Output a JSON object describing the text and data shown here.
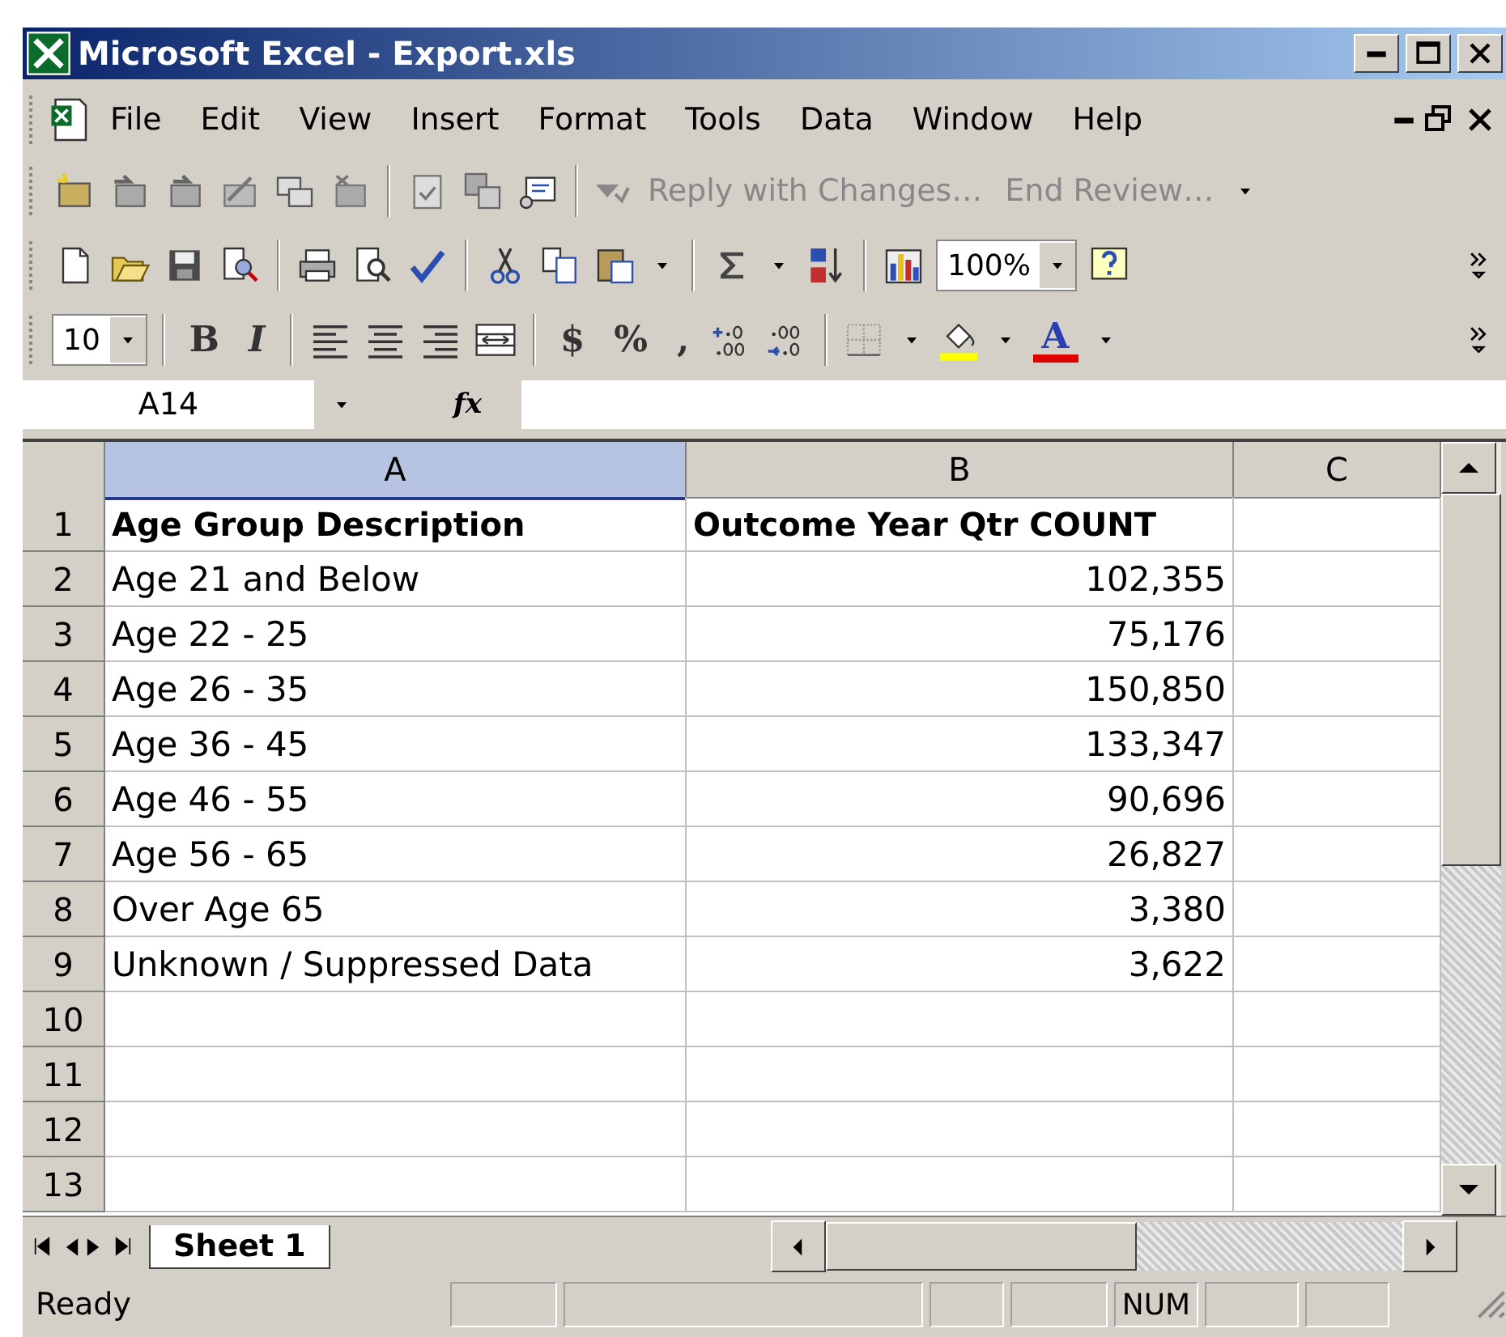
{
  "window": {
    "title": "Microsoft Excel - Export.xls"
  },
  "menu": [
    {
      "label": "File"
    },
    {
      "label": "Edit"
    },
    {
      "label": "View"
    },
    {
      "label": "Insert"
    },
    {
      "label": "Format"
    },
    {
      "label": "Tools"
    },
    {
      "label": "Data"
    },
    {
      "label": "Window"
    },
    {
      "label": "Help"
    }
  ],
  "review_toolbar": {
    "reply": "Reply with Changes…",
    "end_review": "End Review…"
  },
  "standard_toolbar": {
    "zoom": "100%"
  },
  "formatting_toolbar": {
    "font_size": "10",
    "bold": "B",
    "italic": "I",
    "currency": "$",
    "percent": "%",
    "comma": ",",
    "font_color": "A"
  },
  "formula_bar": {
    "name_box": "A14",
    "function_label": "fx"
  },
  "sheet": {
    "columns": [
      {
        "label": "A",
        "selected": true
      },
      {
        "label": "B",
        "selected": false
      },
      {
        "label": "C",
        "selected": false
      }
    ],
    "rows": [
      {
        "number": "1",
        "kind": "header",
        "a": "Age Group Description",
        "b": "Outcome Year Qtr COUNT"
      },
      {
        "number": "2",
        "kind": "data",
        "a": "Age 21 and Below",
        "b": "102,355"
      },
      {
        "number": "3",
        "kind": "data",
        "a": "Age 22 - 25",
        "b": "75,176"
      },
      {
        "number": "4",
        "kind": "data",
        "a": "Age 26 - 35",
        "b": "150,850"
      },
      {
        "number": "5",
        "kind": "data",
        "a": "Age 36 - 45",
        "b": "133,347"
      },
      {
        "number": "6",
        "kind": "data",
        "a": "Age 46 - 55",
        "b": "90,696"
      },
      {
        "number": "7",
        "kind": "data",
        "a": "Age 56 - 65",
        "b": "26,827"
      },
      {
        "number": "8",
        "kind": "data",
        "a": "Over Age 65",
        "b": "3,380"
      },
      {
        "number": "9",
        "kind": "data",
        "a": "Unknown / Suppressed Data",
        "b": "3,622"
      },
      {
        "number": "10",
        "kind": "empty"
      },
      {
        "number": "11",
        "kind": "empty"
      },
      {
        "number": "12",
        "kind": "empty"
      },
      {
        "number": "13",
        "kind": "empty"
      }
    ]
  },
  "sheet_tabs": [
    {
      "label": "Sheet 1",
      "selected": true
    }
  ],
  "status_bar": {
    "text": "Ready",
    "indicators": [
      "NUM"
    ]
  }
}
